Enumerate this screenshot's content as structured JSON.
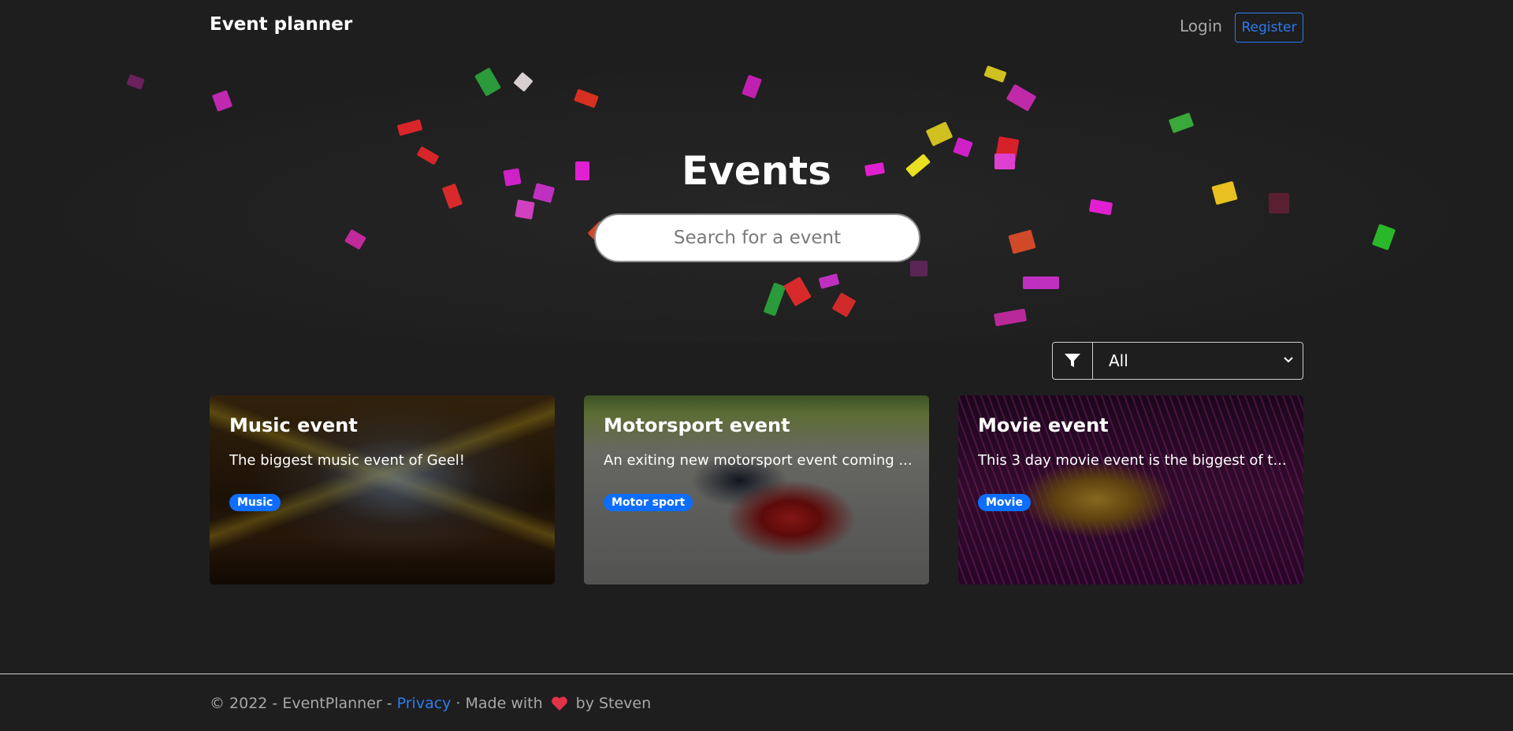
{
  "nav": {
    "brand": "Event planner",
    "login": "Login",
    "register": "Register"
  },
  "hero": {
    "title": "Events",
    "search_placeholder": "Search for a event"
  },
  "filter": {
    "icon": "filter-icon",
    "selected": "All"
  },
  "events": [
    {
      "title": "Music event",
      "description": "The biggest music event of Geel!",
      "badge": "Music"
    },
    {
      "title": "Motorsport event",
      "description": "An exiting new motorsport event coming ...",
      "badge": "Motor sport"
    },
    {
      "title": "Movie event",
      "description": "This 3 day movie event is the biggest of t...",
      "badge": "Movie"
    }
  ],
  "footer": {
    "copyright": "© 2022 - EventPlanner -",
    "privacy": "Privacy",
    "made_with": "· Made with",
    "by": "by Steven",
    "heart_icon": "heart-icon"
  },
  "colors": {
    "background": "#1e1e1e",
    "accent": "#2e7bf0",
    "badge": "#0d6efd",
    "heart": "#e0334a"
  }
}
